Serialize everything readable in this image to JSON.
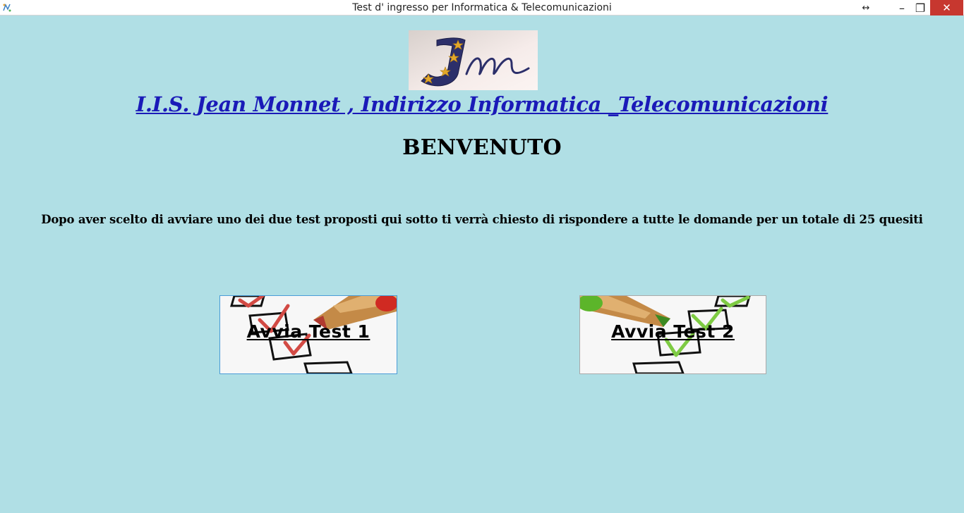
{
  "window": {
    "title": "Test d' ingresso per Informatica & Telecomunicazioni",
    "controls": {
      "resize": "↔",
      "minimize": "–",
      "maximize": "❐",
      "close": "✕"
    }
  },
  "header": {
    "school_link": "I.I.S. Jean Monnet , Indirizzo Informatica _Telecomunicazioni",
    "welcome": "BENVENUTO"
  },
  "intro_text": "Dopo aver scelto di avviare uno dei due test proposti qui sotto ti verrà chiesto di rispondere a tutte le domande per un totale di 25 quesiti",
  "buttons": {
    "test1": {
      "label": "Avvia Test 1",
      "accent": "#c93a36"
    },
    "test2": {
      "label": "Avvia Test 2",
      "accent": "#6cc23a"
    }
  },
  "colors": {
    "background": "#b0dfe5",
    "link": "#1a1ab8",
    "close_button": "#c7372f"
  }
}
